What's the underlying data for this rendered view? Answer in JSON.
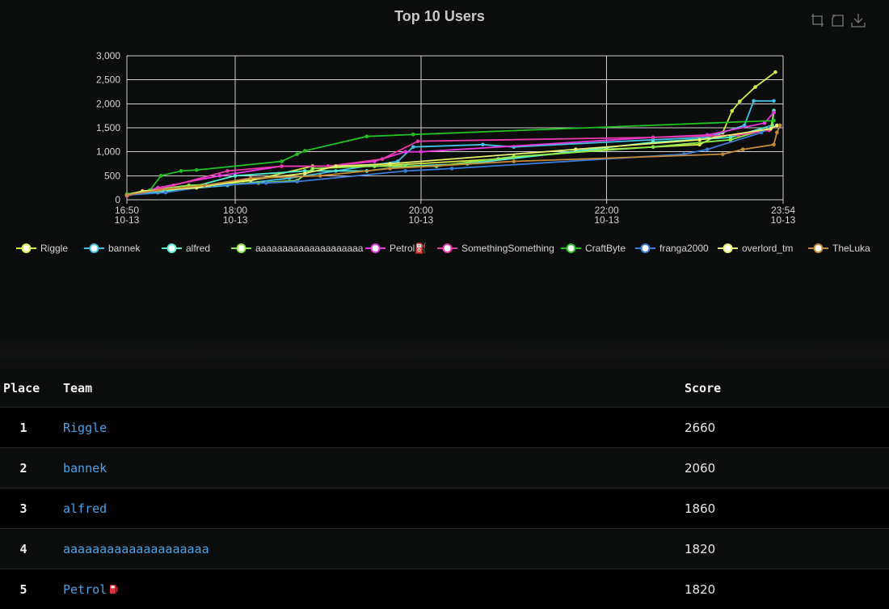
{
  "chart": {
    "title": "Top 10 Users",
    "toolbox": [
      {
        "name": "zoom-icon"
      },
      {
        "name": "zoom-reset-icon"
      },
      {
        "name": "download-icon"
      }
    ]
  },
  "chart_data": {
    "type": "line",
    "title": "Top 10 Users",
    "xlabel": "",
    "ylabel": "",
    "x_ticks": [
      {
        "time": "16:50",
        "date": "10-13"
      },
      {
        "time": "18:00",
        "date": "10-13"
      },
      {
        "time": "20:00",
        "date": "10-13"
      },
      {
        "time": "22:00",
        "date": "10-13"
      },
      {
        "time": "23:54",
        "date": "10-13"
      }
    ],
    "xlim": [
      "16:50",
      "23:54"
    ],
    "y_ticks": [
      "0",
      "500",
      "1,000",
      "1,500",
      "2,000",
      "2,500",
      "3,000"
    ],
    "ylim": [
      0,
      3000
    ],
    "grid": true,
    "legend_position": "bottom",
    "series": [
      {
        "name": "Riggle",
        "color": "#d7ea48",
        "points": [
          [
            "16:50",
            100
          ],
          [
            "17:10",
            200
          ],
          [
            "17:40",
            300
          ],
          [
            "18:10",
            400
          ],
          [
            "18:50",
            700
          ],
          [
            "19:30",
            700
          ],
          [
            "20:50",
            850
          ],
          [
            "22:00",
            1050
          ],
          [
            "23:00",
            1150
          ],
          [
            "23:15",
            1400
          ],
          [
            "23:21",
            1850
          ],
          [
            "23:26",
            2050
          ],
          [
            "23:36",
            2350
          ],
          [
            "23:49",
            2660
          ]
        ]
      },
      {
        "name": "bannek",
        "color": "#42bfe3",
        "points": [
          [
            "16:50",
            100
          ],
          [
            "17:20",
            200
          ],
          [
            "17:55",
            300
          ],
          [
            "18:35",
            450
          ],
          [
            "19:05",
            600
          ],
          [
            "19:45",
            800
          ],
          [
            "19:55",
            1100
          ],
          [
            "20:40",
            1150
          ],
          [
            "21:00",
            1100
          ],
          [
            "22:30",
            1250
          ],
          [
            "23:05",
            1300
          ],
          [
            "23:29",
            1550
          ],
          [
            "23:35",
            2060
          ],
          [
            "23:48",
            2060
          ]
        ]
      },
      {
        "name": "alfred",
        "color": "#52eed4",
        "points": [
          [
            "16:50",
            100
          ],
          [
            "17:10",
            150
          ],
          [
            "17:30",
            250
          ],
          [
            "18:00",
            500
          ],
          [
            "18:45",
            600
          ],
          [
            "19:25",
            600
          ],
          [
            "19:50",
            700
          ],
          [
            "20:30",
            750
          ],
          [
            "22:30",
            1200
          ],
          [
            "23:20",
            1300
          ],
          [
            "23:47",
            1550
          ],
          [
            "23:48",
            1860
          ]
        ]
      },
      {
        "name": "aaaaaaaaaaaaaaaaaaaa",
        "color": "#8fe84a",
        "points": [
          [
            "16:50",
            100
          ],
          [
            "17:05",
            200
          ],
          [
            "17:30",
            300
          ],
          [
            "18:15",
            350
          ],
          [
            "18:40",
            400
          ],
          [
            "18:50",
            650
          ],
          [
            "19:30",
            700
          ],
          [
            "20:10",
            700
          ],
          [
            "21:00",
            900
          ],
          [
            "22:30",
            1100
          ],
          [
            "23:20",
            1250
          ],
          [
            "23:46",
            1500
          ],
          [
            "23:48",
            1820
          ]
        ]
      },
      {
        "name": "Petrol⛽",
        "color": "#e838e0",
        "points": [
          [
            "16:50",
            80
          ],
          [
            "17:10",
            250
          ],
          [
            "17:50",
            500
          ],
          [
            "18:30",
            700
          ],
          [
            "19:00",
            700
          ],
          [
            "19:30",
            800
          ],
          [
            "19:50",
            1000
          ],
          [
            "20:00",
            1000
          ],
          [
            "22:30",
            1300
          ],
          [
            "23:05",
            1350
          ],
          [
            "23:42",
            1600
          ],
          [
            "23:48",
            1820
          ]
        ]
      },
      {
        "name": "SomethingSomething",
        "color": "#e83aa8",
        "points": [
          [
            "16:50",
            80
          ],
          [
            "17:20",
            300
          ],
          [
            "17:55",
            600
          ],
          [
            "18:30",
            700
          ],
          [
            "19:00",
            700
          ],
          [
            "19:35",
            850
          ],
          [
            "19:58",
            1220
          ],
          [
            "22:30",
            1300
          ],
          [
            "23:25",
            1350
          ],
          [
            "23:45",
            1450
          ]
        ]
      },
      {
        "name": "CraftByte",
        "color": "#22c021",
        "points": [
          [
            "16:50",
            120
          ],
          [
            "17:05",
            200
          ],
          [
            "17:12",
            500
          ],
          [
            "17:25",
            600
          ],
          [
            "17:35",
            620
          ],
          [
            "18:30",
            800
          ],
          [
            "18:40",
            950
          ],
          [
            "18:45",
            1020
          ],
          [
            "19:25",
            1320
          ],
          [
            "19:55",
            1360
          ],
          [
            "23:48",
            1650
          ]
        ]
      },
      {
        "name": "franga2000",
        "color": "#3a7bd8",
        "points": [
          [
            "16:50",
            100
          ],
          [
            "17:15",
            150
          ],
          [
            "17:45",
            300
          ],
          [
            "18:20",
            350
          ],
          [
            "18:40",
            380
          ],
          [
            "19:50",
            600
          ],
          [
            "20:20",
            650
          ],
          [
            "22:50",
            950
          ],
          [
            "23:05",
            1050
          ],
          [
            "23:40",
            1400
          ],
          [
            "23:45",
            1500
          ]
        ]
      },
      {
        "name": "overlord_tm",
        "color": "#e8f06c",
        "points": [
          [
            "16:50",
            100
          ],
          [
            "17:00",
            180
          ],
          [
            "17:35",
            250
          ],
          [
            "18:05",
            400
          ],
          [
            "18:45",
            550
          ],
          [
            "19:05",
            700
          ],
          [
            "19:40",
            750
          ],
          [
            "21:40",
            1050
          ],
          [
            "23:00",
            1250
          ],
          [
            "23:46",
            1480
          ],
          [
            "23:50",
            1550
          ]
        ]
      },
      {
        "name": "TheLuka",
        "color": "#c48a38",
        "points": [
          [
            "16:50",
            100
          ],
          [
            "17:10",
            200
          ],
          [
            "17:40",
            300
          ],
          [
            "18:10",
            450
          ],
          [
            "18:55",
            500
          ],
          [
            "19:40",
            650
          ],
          [
            "21:00",
            800
          ],
          [
            "23:15",
            950
          ],
          [
            "23:28",
            1050
          ],
          [
            "23:48",
            1150
          ],
          [
            "23:50",
            1400
          ],
          [
            "23:52",
            1550
          ]
        ]
      }
    ]
  },
  "leaderboard": {
    "headers": {
      "place": "Place",
      "team": "Team",
      "score": "Score"
    },
    "rows": [
      {
        "place": "1",
        "team": "Riggle",
        "score": "2660"
      },
      {
        "place": "2",
        "team": "bannek",
        "score": "2060"
      },
      {
        "place": "3",
        "team": "alfred",
        "score": "1860"
      },
      {
        "place": "4",
        "team": "aaaaaaaaaaaaaaaaaaaa",
        "score": "1820"
      },
      {
        "place": "5",
        "team": "Petrol",
        "team_icon": "fuel-pump-icon",
        "score": "1820"
      }
    ]
  }
}
